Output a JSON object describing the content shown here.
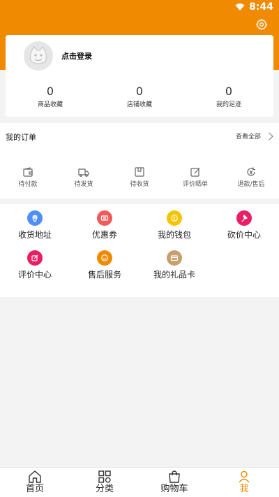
{
  "status_bar": {
    "time": "8:44"
  },
  "colors": {
    "accent": "#f08a00"
  },
  "profile": {
    "login_text": "点击登录",
    "stats": [
      {
        "count": "0",
        "label": "商品收藏"
      },
      {
        "count": "0",
        "label": "店铺收藏"
      },
      {
        "count": "0",
        "label": "我的足迹"
      }
    ]
  },
  "orders": {
    "title": "我的订单",
    "view_all": "查看全部",
    "items": [
      {
        "label": "待付款",
        "icon": "wallet-icon"
      },
      {
        "label": "待发货",
        "icon": "truck-icon"
      },
      {
        "label": "待收货",
        "icon": "box-icon"
      },
      {
        "label": "评价晒单",
        "icon": "edit-icon"
      },
      {
        "label": "退款/售后",
        "icon": "refund-icon"
      }
    ]
  },
  "services": [
    {
      "label": "收货地址",
      "color": "#4f8ef7",
      "icon": "location-icon"
    },
    {
      "label": "优惠券",
      "color": "#ef5a5a",
      "icon": "coupon-icon"
    },
    {
      "label": "我的钱包",
      "color": "#f5c400",
      "icon": "coin-icon"
    },
    {
      "label": "砍价中心",
      "color": "#e91e63",
      "icon": "axe-icon"
    },
    {
      "label": "评价中心",
      "color": "#e91e63",
      "icon": "edit-icon"
    },
    {
      "label": "售后服务",
      "color": "#f08a00",
      "icon": "service-icon"
    },
    {
      "label": "我的礼品卡",
      "color": "#c8a06e",
      "icon": "card-icon"
    }
  ],
  "nav": [
    {
      "label": "首页",
      "icon": "home-icon"
    },
    {
      "label": "分类",
      "icon": "grid-icon"
    },
    {
      "label": "购物车",
      "icon": "cart-icon"
    },
    {
      "label": "我",
      "icon": "user-icon"
    }
  ]
}
